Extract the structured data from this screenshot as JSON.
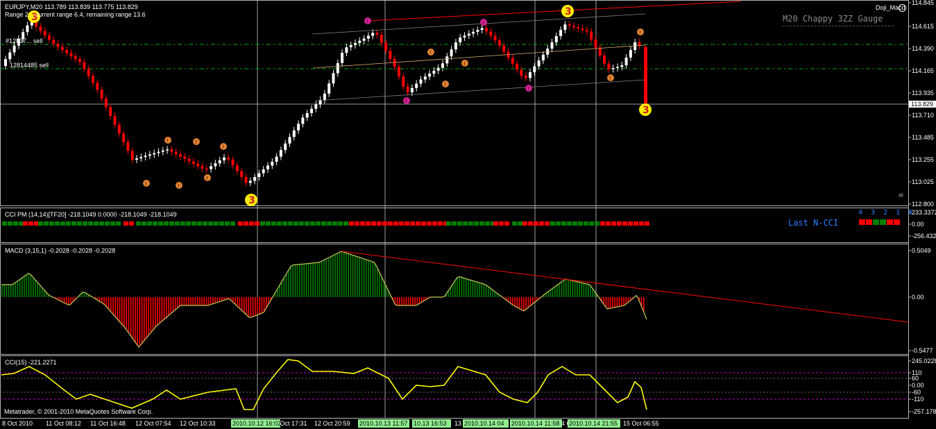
{
  "chart_data": [
    {
      "type": "candlestick",
      "title": "EURJPY,M20  113.789 113.839 113.775 113.829",
      "subtitle": "Range 2... current range 6.4, remaining range 13.6",
      "indicator_name": "Doji_Macd",
      "gauge_title": "M20 Chappy 3ZZ Gauge",
      "ylim": [
        112.8,
        114.9
      ],
      "yticks": [
        "114.845",
        "114.615",
        "114.390",
        "114.165",
        "113.935",
        "113.829",
        "113.710",
        "113.485",
        "113.255",
        "113.025",
        "112.800"
      ],
      "current_price": "113.829",
      "order_labels": [
        "#12837... sell",
        "12814485 sell"
      ],
      "zigzag_labels": [
        "3",
        "3",
        "3",
        "3"
      ]
    },
    {
      "type": "bar",
      "title": "CCI PM (14,14)[TF20] -218.1049 0.0000 -218.1049 -218.1049",
      "yticks": [
        "233.3372",
        "0.00",
        "-256.4323"
      ],
      "panel_label": "Last N-CCI",
      "digits": "4 3 2 1 0",
      "tf_colors": [
        "#ff0000",
        "#ff0000",
        "#008000",
        "#008000",
        "#ff0000",
        "#ff0000"
      ]
    },
    {
      "type": "bar",
      "title": "MACD (3,15,1) -0.2028 -0.2028 -0.2028",
      "yticks": [
        "0.5049",
        "0.00",
        "-0.5477"
      ],
      "ylim": [
        -0.5477,
        0.5049
      ]
    },
    {
      "type": "line",
      "title": "CCI(15) -221.2271",
      "yticks": [
        "245.0228",
        "110",
        "60",
        "0.00",
        "-60",
        "-110",
        "-257.1788"
      ],
      "levels": [
        110,
        60,
        0,
        -60,
        -110
      ],
      "ylim": [
        -257.1788,
        245.0228
      ]
    }
  ],
  "time_axis": {
    "labels": [
      "8 Oct 2010",
      "11 Oct 08:12",
      "11 Oct 16:48",
      "12 Oct 07:54",
      "12 Oct 10:33",
      "12 Oct 17:31",
      "12 Oct 20:59",
      "13 Oct",
      "14 Oct",
      "15 Oct 06:55"
    ],
    "highlight_labels": [
      "2010.10.12 16:02",
      "2010.10.13 11:57",
      "10.13 16:53",
      "2010.10.14 04",
      "2010.10.14 11:58",
      "2010.10.14 21:55"
    ]
  },
  "copyright": "Metatrader, © 2001-2010 MetaQuotes Software Corp.",
  "colors": {
    "bull": "#ffffff",
    "bear": "#ff0000",
    "grid": "#808080",
    "axis": "#b4b4b4",
    "macd_up": "#008000",
    "macd_down": "#ff0000",
    "macd_line": "#c8c85a",
    "cci_line": "#ffff00",
    "level_line": "#c000c0",
    "hline_green": "#00b000",
    "zigzag_ball": "#ffee00",
    "pivot_orange": "#e08030",
    "pivot_magenta": "#d02090"
  }
}
